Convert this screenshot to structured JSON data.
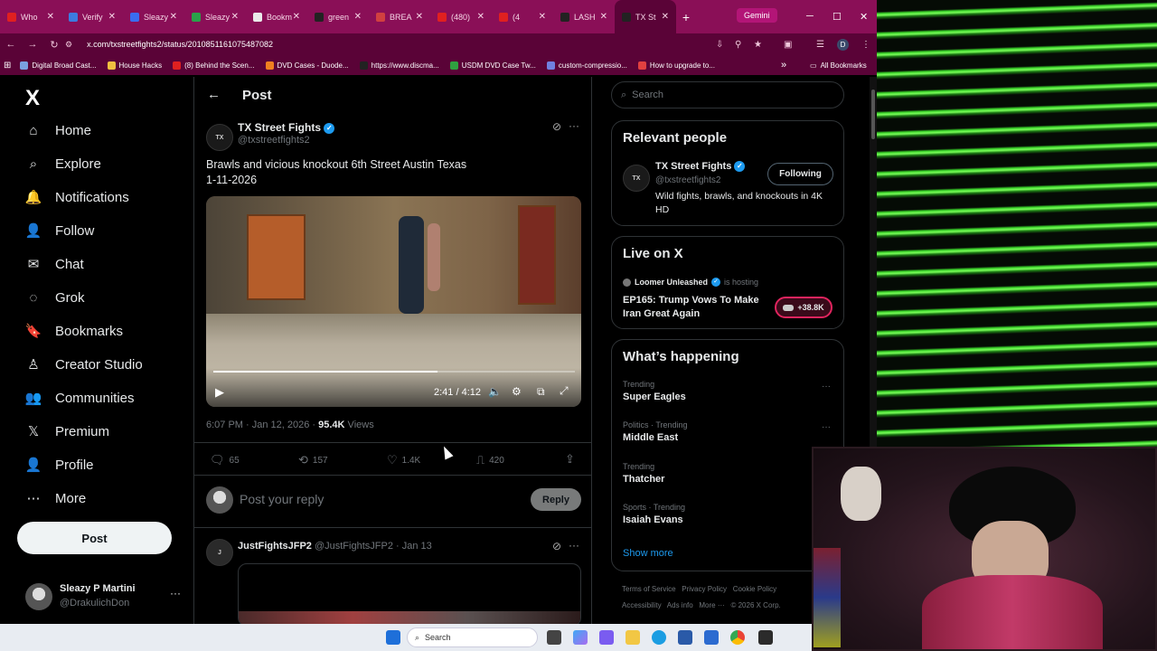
{
  "browser": {
    "tabs": [
      {
        "label": "Who",
        "color": "#e02020"
      },
      {
        "label": "Verify",
        "color": "#3c7be0"
      },
      {
        "label": "Sleazy",
        "color": "#3a6cf0"
      },
      {
        "label": "Sleazy",
        "color": "#2aa14a"
      },
      {
        "label": "Bookm",
        "color": "#eaeaea"
      },
      {
        "label": "green",
        "color": "#222222"
      },
      {
        "label": "BREA",
        "color": "#d04040"
      },
      {
        "label": "(480)",
        "color": "#e02020"
      },
      {
        "label": "(4",
        "color": "#e02020"
      },
      {
        "label": "LASH",
        "color": "#222222"
      },
      {
        "label": "TX St",
        "color": "#222222"
      }
    ],
    "new_tab": "+",
    "gemini_label": "Gemini",
    "window_controls": {
      "minimize": "─",
      "maximize": "☐",
      "close": "✕"
    },
    "url": "x.com/txstreetfights2/status/2010851161075487082",
    "bookmarks": [
      {
        "label": "Digital Broad Cast...",
        "color": "#7aa0e0"
      },
      {
        "label": "House Hacks",
        "color": "#f0c040"
      },
      {
        "label": "(8) Behind the Scen...",
        "color": "#e02020"
      },
      {
        "label": "DVD Cases - Duode...",
        "color": "#f08020"
      },
      {
        "label": "https://www.discma...",
        "color": "#222222"
      },
      {
        "label": "USDM DVD Case Tw...",
        "color": "#30a040"
      },
      {
        "label": "custom-compressio...",
        "color": "#7080e0"
      },
      {
        "label": "How to upgrade to...",
        "color": "#e04040"
      }
    ],
    "bookmarks_more": "»",
    "all_bookmarks": "All Bookmarks",
    "profile_initial": "D"
  },
  "nav": {
    "logo": "X",
    "items": [
      {
        "label": "Home",
        "icon": "⌂"
      },
      {
        "label": "Explore",
        "icon": "⌕"
      },
      {
        "label": "Notifications",
        "icon": "🔔"
      },
      {
        "label": "Follow",
        "icon": "👤"
      },
      {
        "label": "Chat",
        "icon": "✉"
      },
      {
        "label": "Grok",
        "icon": "◌"
      },
      {
        "label": "Bookmarks",
        "icon": "🔖"
      },
      {
        "label": "Creator Studio",
        "icon": "♙"
      },
      {
        "label": "Communities",
        "icon": "👥"
      },
      {
        "label": "Premium",
        "icon": "𝕏"
      },
      {
        "label": "Profile",
        "icon": "👤"
      },
      {
        "label": "More",
        "icon": "⋯"
      }
    ],
    "post_button": "Post",
    "account": {
      "name": "Sleazy P Martini",
      "handle": "@DrakulichDon",
      "more": "···"
    }
  },
  "post": {
    "header_title": "Post",
    "back": "←",
    "author_name": "TX Street Fights",
    "author_handle": "@txstreetfights2",
    "text_line1": "Brawls and vicious knockout 6th Street Austin Texas",
    "text_line2": "1-11-2026",
    "video": {
      "time": "2:41 / 4:12",
      "progress": 0.62
    },
    "timestamp": "6:07 PM · Jan 12, 2026 · ",
    "views_count": "95.4K",
    "views_label": " Views",
    "stats": {
      "replies": "65",
      "reposts": "157",
      "likes": "1.4K",
      "bookmarks": "420"
    },
    "reply_placeholder": "Post your reply",
    "reply_button": "Reply"
  },
  "reply": {
    "author_name": "JustFightsJFP2",
    "author_handle": "@JustFightsJFP2 · Jan 13"
  },
  "sidebar": {
    "search_placeholder": "Search",
    "relevant_title": "Relevant people",
    "relevant_person": {
      "name": "TX Street Fights",
      "handle": "@txstreetfights2",
      "bio": "Wild fights, brawls, and knockouts in 4K HD",
      "button": "Following"
    },
    "live_title": "Live on X",
    "live": {
      "host": "Loomer Unleashed",
      "status": "is hosting",
      "title": "EP165: Trump Vows To Make Iran Great Again",
      "listeners": "+38.8K"
    },
    "happening_title": "What’s happening",
    "trends": [
      {
        "category": "Trending",
        "title": "Super Eagles"
      },
      {
        "category": "Politics · Trending",
        "title": "Middle East"
      },
      {
        "category": "Trending",
        "title": "Thatcher"
      },
      {
        "category": "Sports · Trending",
        "title": "Isaiah Evans"
      }
    ],
    "show_more": "Show more",
    "footer_line1": "Terms of Service   Privacy Policy   Cookie Policy",
    "footer_line2": "Accessibility   Ads info   More ···   © 2026 X Corp."
  },
  "taskbar": {
    "search_label": "Search"
  }
}
